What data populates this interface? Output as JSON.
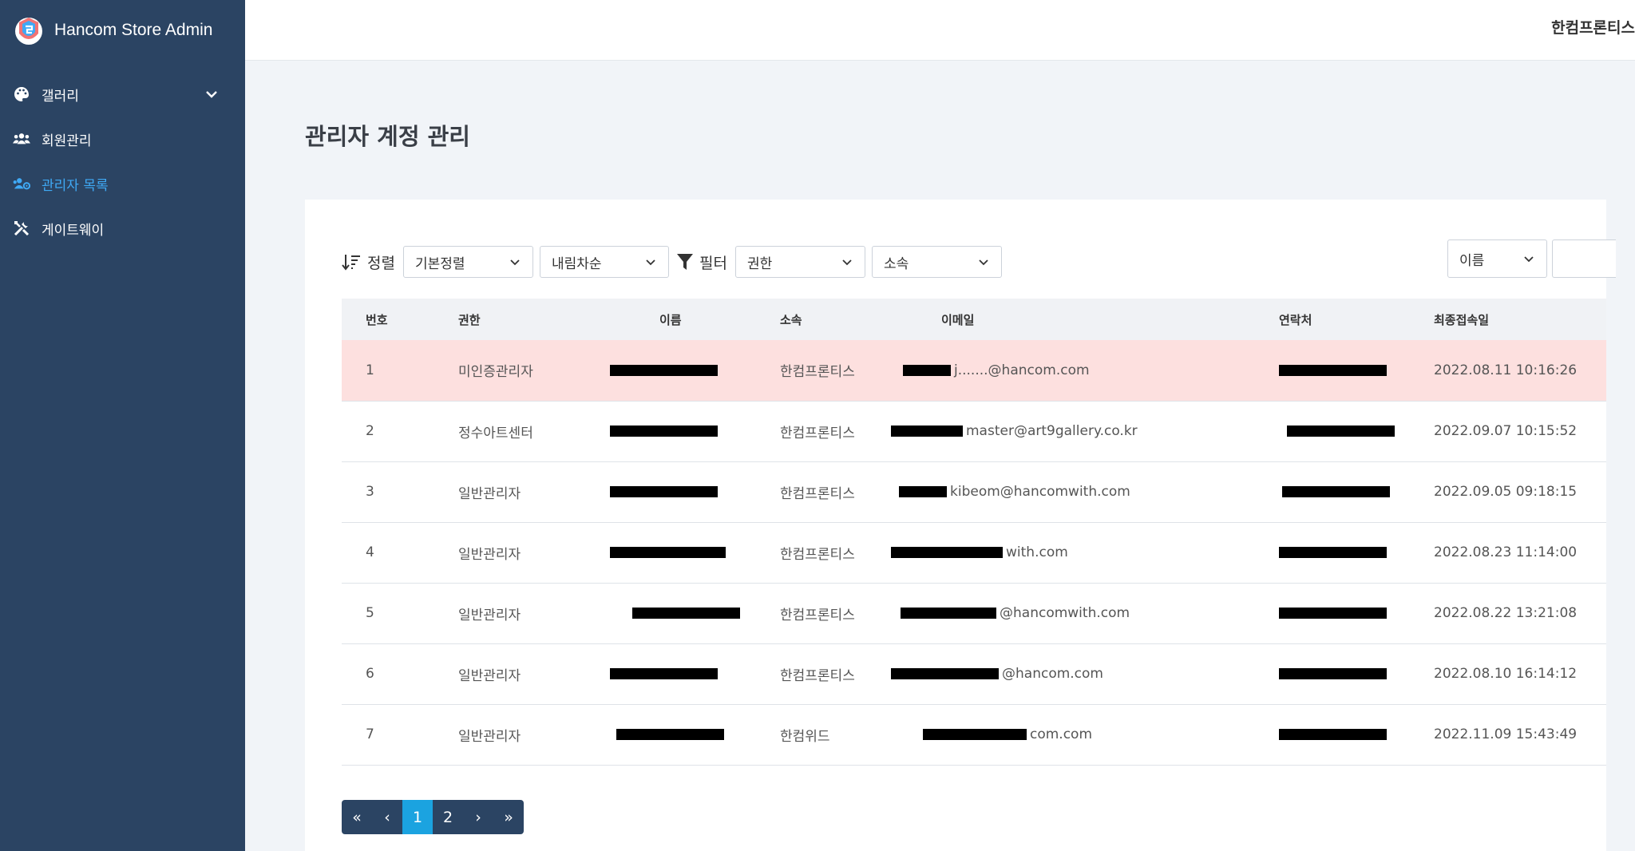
{
  "app": {
    "title": "Hancom Store Admin"
  },
  "sidebar": {
    "items": [
      {
        "label": "갤러리",
        "icon": "palette-icon",
        "expandable": true
      },
      {
        "label": "회원관리",
        "icon": "users-icon"
      },
      {
        "label": "관리자 목록",
        "icon": "users-cog-icon",
        "active": true
      },
      {
        "label": "게이트웨이",
        "icon": "tools-icon"
      }
    ]
  },
  "header": {
    "user": "한컴프론티스"
  },
  "page": {
    "title": "관리자 계정 관리"
  },
  "toolbar": {
    "sort_label": "정렬",
    "sort_value": "기본정렬",
    "order_value": "내림차순",
    "filter_label": "필터",
    "auth_value": "권한",
    "affiliation_value": "소속",
    "search_field_value": "이름",
    "search_value": ""
  },
  "table": {
    "headers": [
      "번호",
      "권한",
      "이름",
      "소속",
      "이메일",
      "연락처",
      "최종접속일"
    ],
    "rows": [
      {
        "no": "1",
        "role": "미인증관리자",
        "affiliation": "한컴프론티스",
        "email_visible": "j.......@hancom.com",
        "last_login": "2022.08.11 10:16:26"
      },
      {
        "no": "2",
        "role": "정수아트센터",
        "affiliation": "한컴프론티스",
        "email_visible": "master@art9gallery.co.kr",
        "last_login": "2022.09.07 10:15:52"
      },
      {
        "no": "3",
        "role": "일반관리자",
        "affiliation": "한컴프론티스",
        "email_visible": "kibeom@hancomwith.com",
        "last_login": "2022.09.05 09:18:15"
      },
      {
        "no": "4",
        "role": "일반관리자",
        "affiliation": "한컴프론티스",
        "email_visible": "with.com",
        "last_login": "2022.08.23 11:14:00"
      },
      {
        "no": "5",
        "role": "일반관리자",
        "affiliation": "한컴프론티스",
        "email_visible": "@hancomwith.com",
        "last_login": "2022.08.22 13:21:08"
      },
      {
        "no": "6",
        "role": "일반관리자",
        "affiliation": "한컴프론티스",
        "email_visible": "@hancom.com",
        "last_login": "2022.08.10 16:14:12"
      },
      {
        "no": "7",
        "role": "일반관리자",
        "affiliation": "한컴위드",
        "email_visible": "com.com",
        "last_login": "2022.11.09 15:43:49"
      }
    ]
  },
  "pagination": {
    "first": "«",
    "prev": "‹",
    "pages": [
      "1",
      "2"
    ],
    "current": "1",
    "next": "›",
    "last": "»"
  },
  "colors": {
    "sidebar_bg": "#2b4463",
    "accent": "#1ba3e0",
    "active_nav": "#3fa9f5",
    "highlight_row": "#fde0df"
  }
}
